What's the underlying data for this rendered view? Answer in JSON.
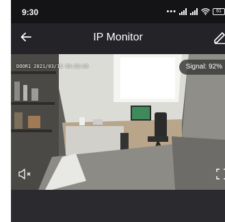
{
  "status_bar": {
    "time": "9:30",
    "battery": "61"
  },
  "app_bar": {
    "title": "IP Monitor",
    "back_icon": "arrow-left-icon",
    "edit_icon": "pencil-icon"
  },
  "video": {
    "osd_text": "DOOR1 2021/03/18 09:30:06",
    "signal_text": "Signal: 92%",
    "mute_icon": "speaker-muted-icon",
    "fullscreen_icon": "fullscreen-icon"
  },
  "colors": {
    "background": "#232328",
    "status_bar": "#141417",
    "text": "#ffffff"
  }
}
